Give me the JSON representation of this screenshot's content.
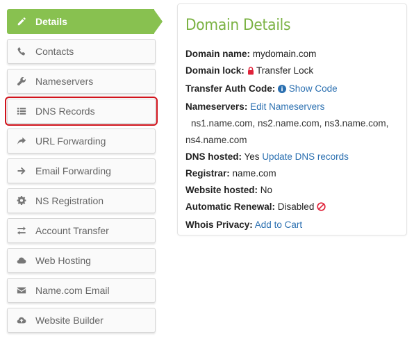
{
  "sidebar": {
    "items": [
      {
        "label": "Details",
        "icon": "pencil-icon"
      },
      {
        "label": "Contacts",
        "icon": "phone-icon"
      },
      {
        "label": "Nameservers",
        "icon": "wrench-icon"
      },
      {
        "label": "DNS Records",
        "icon": "list-icon"
      },
      {
        "label": "URL Forwarding",
        "icon": "share-arrow-icon"
      },
      {
        "label": "Email Forwarding",
        "icon": "arrow-right-icon"
      },
      {
        "label": "NS Registration",
        "icon": "gear-icon"
      },
      {
        "label": "Account Transfer",
        "icon": "transfer-arrows-icon"
      },
      {
        "label": "Web Hosting",
        "icon": "cloud-icon"
      },
      {
        "label": "Name.com Email",
        "icon": "envelope-icon"
      },
      {
        "label": "Website Builder",
        "icon": "cloud-upload-icon"
      }
    ],
    "active_index": 0,
    "highlighted_index": 3
  },
  "details": {
    "title": "Domain Details",
    "domain_name_label": "Domain name:",
    "domain_name": "mydomain.com",
    "domain_lock_label": "Domain lock:",
    "domain_lock_value": "Transfer Lock",
    "auth_code_label": "Transfer Auth Code:",
    "auth_code_link": "Show Code",
    "nameservers_label": "Nameservers:",
    "nameservers_link": "Edit Nameservers",
    "nameservers_line1": "ns1.name.com, ns2.name.com, ns3.name.com,",
    "nameservers_line2": "ns4.name.com",
    "dns_hosted_label": "DNS hosted:",
    "dns_hosted_value": "Yes",
    "dns_hosted_link": "Update DNS records",
    "registrar_label": "Registrar:",
    "registrar_value": "name.com",
    "website_hosted_label": "Website hosted:",
    "website_hosted_value": "No",
    "auto_renewal_label": "Automatic Renewal:",
    "auto_renewal_value": "Disabled",
    "whois_label": "Whois Privacy:",
    "whois_link": "Add to Cart"
  },
  "colors": {
    "accent_green": "#88c150",
    "title_green": "#7bb243",
    "link_blue": "#2a6fb0",
    "highlight_red": "#d0121b"
  }
}
